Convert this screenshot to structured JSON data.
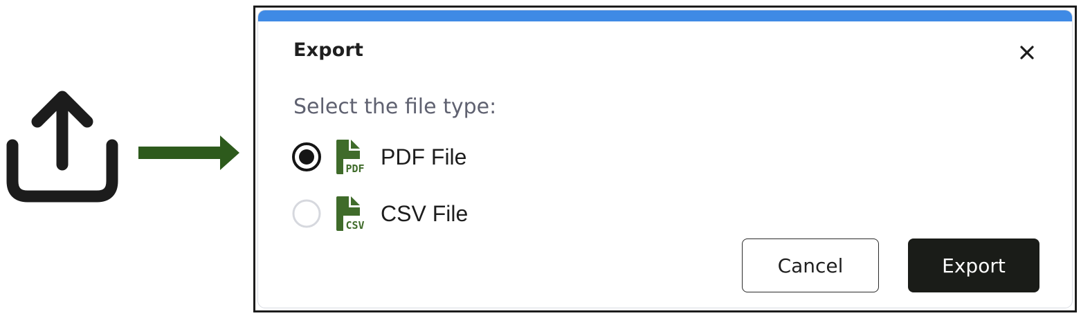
{
  "dialog": {
    "title": "Export",
    "prompt": "Select the file type:",
    "options": [
      {
        "label": "PDF File",
        "icon": "pdf-file-icon",
        "icon_badge": "PDF",
        "selected": true
      },
      {
        "label": "CSV File",
        "icon": "csv-file-icon",
        "icon_badge": "CSV",
        "selected": false
      }
    ],
    "cancel_label": "Cancel",
    "export_label": "Export"
  },
  "icons": {
    "trigger": "upload-icon",
    "flow": "arrow-right-icon",
    "close": "close-icon"
  },
  "colors": {
    "accent": "#3f8ae5",
    "file_icon_green": "#3f6b2a",
    "flow_arrow_green": "#2d5a1c",
    "primary_button": "#1a1c18"
  }
}
